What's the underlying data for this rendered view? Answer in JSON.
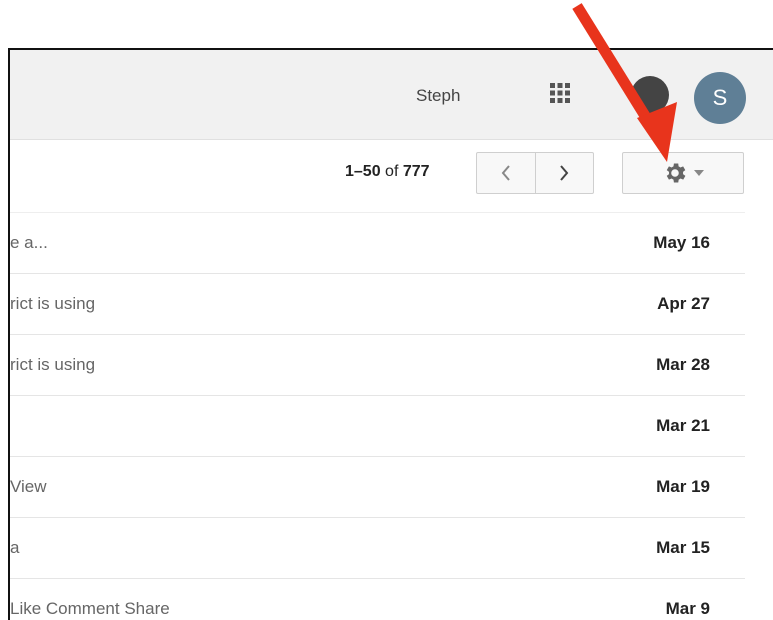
{
  "header": {
    "user_name": "Steph",
    "avatar_letter": "S"
  },
  "toolbar": {
    "range": "1–50",
    "of_label": "of",
    "total": "777"
  },
  "messages": [
    {
      "snippet": "e a...",
      "date": "May 16"
    },
    {
      "snippet": "rict is using",
      "date": "Apr 27"
    },
    {
      "snippet": "rict is using",
      "date": "Mar 28"
    },
    {
      "snippet": "",
      "date": "Mar 21"
    },
    {
      "snippet": "View",
      "date": "Mar 19"
    },
    {
      "snippet": "a",
      "date": "Mar 15"
    },
    {
      "snippet": "Like Comment Share",
      "date": "Mar 9"
    }
  ],
  "colors": {
    "annotation_arrow": "#e8341c",
    "avatar": "#5f7f96"
  },
  "icons": [
    "apps-grid-icon",
    "notifications-icon",
    "chevron-left-icon",
    "chevron-right-icon",
    "gear-icon",
    "caret-down-icon",
    "red-arrow-annotation"
  ]
}
